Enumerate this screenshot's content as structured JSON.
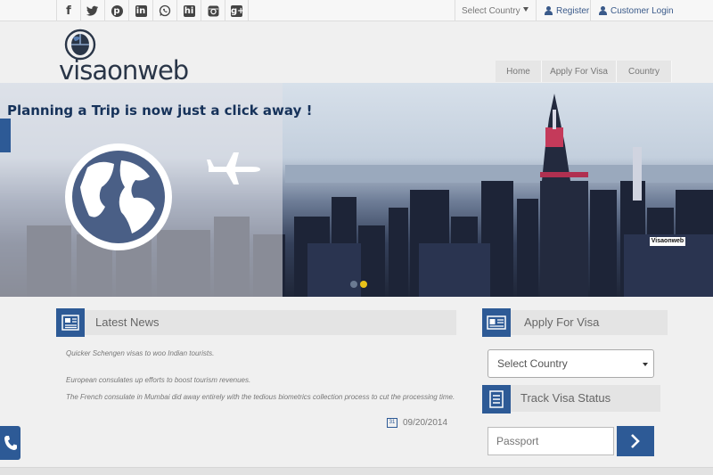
{
  "social": [
    "facebook-icon",
    "twitter-icon",
    "pinterest-icon",
    "linkedin-icon",
    "whatsapp-icon",
    "hi5-icon",
    "instagram-icon",
    "google-plus-icon"
  ],
  "topbar": {
    "country_select": "Select Country",
    "register": "Register",
    "customer_login": "Customer Login"
  },
  "logo": {
    "part1": "visa",
    "part2": "onweb"
  },
  "nav": {
    "home": "Home",
    "apply": "Apply For Visa",
    "country": "Country"
  },
  "banner": {
    "tagline": "Planning a Trip is now just a click away !",
    "watermark": "Visaonweb"
  },
  "news": {
    "title": "Latest News",
    "items": [
      "Quicker Schengen visas to woo Indian tourists.",
      "European consulates up efforts to boost tourism revenues.",
      "The French consulate in Mumbai did away entirely with the tedious biometrics collection process to cut the processing time."
    ],
    "date": "09/20/2014",
    "calendar_glyph": "31"
  },
  "apply": {
    "title": "Apply For Visa",
    "select_value": "Select Country"
  },
  "track": {
    "title": "Track Visa Status",
    "passport_placeholder": "Passport"
  },
  "colors": {
    "brand_blue": "#2d5a96",
    "dark_navy": "#2a3648",
    "accent_yellow": "#e8c21a"
  }
}
